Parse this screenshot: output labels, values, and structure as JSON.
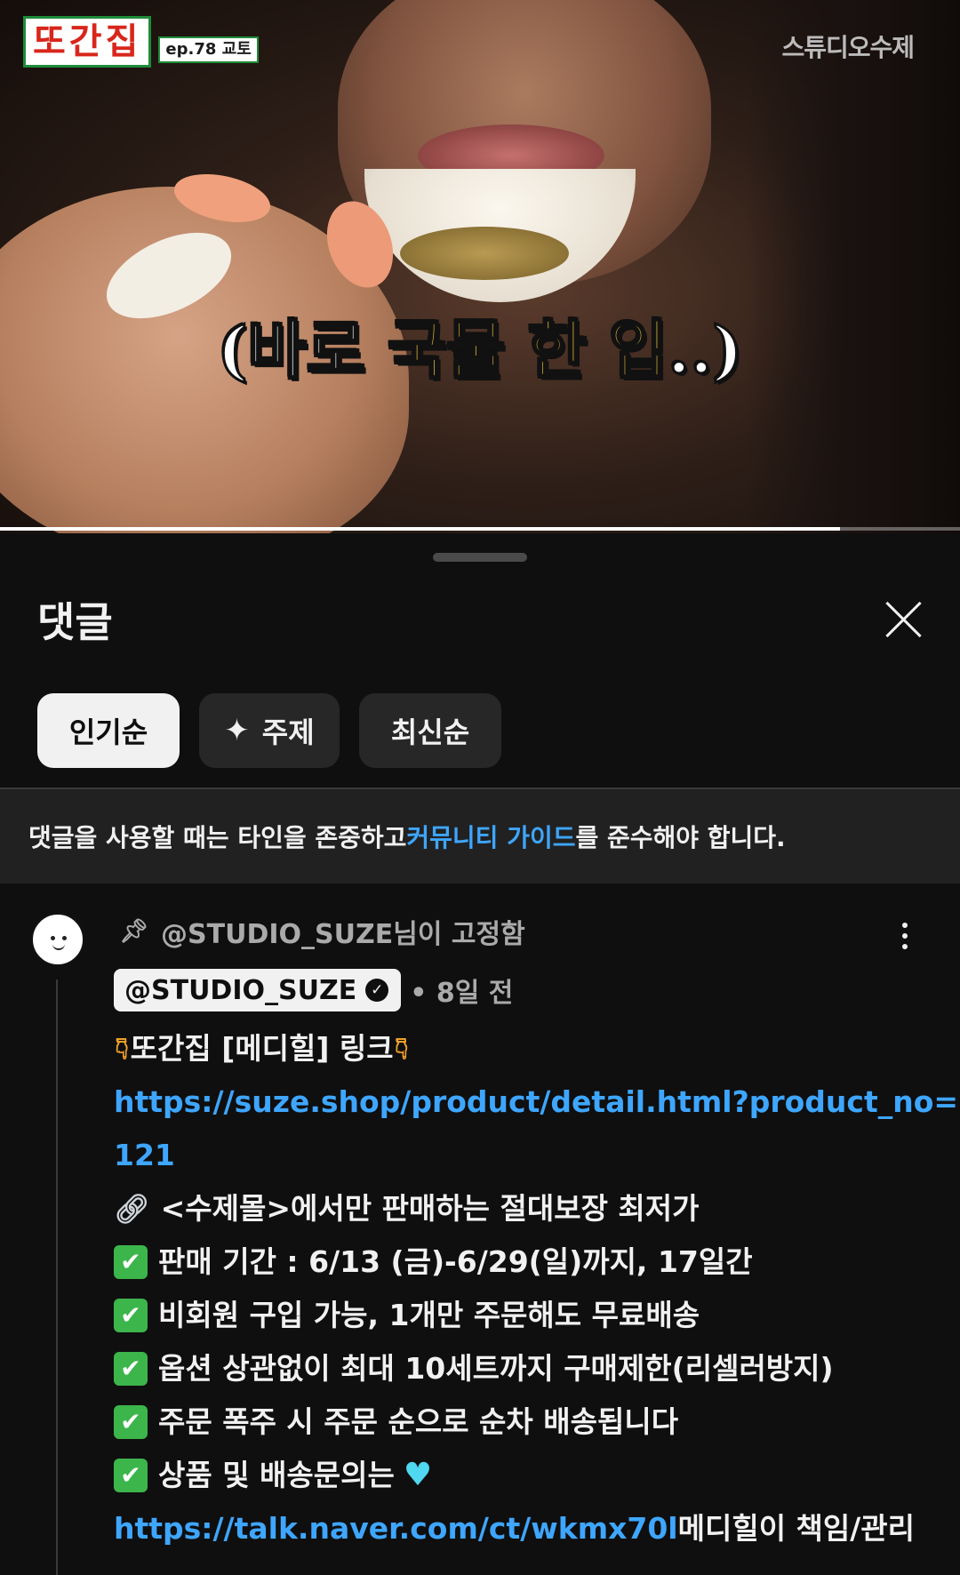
{
  "video": {
    "logo_title": "또간집",
    "logo_episode": "ep.78 교토",
    "watermark": "스튜디오수제",
    "subtitle_white": "(바로 ",
    "subtitle_yellow": "국물 한 입",
    "subtitle_end": "..)",
    "progress_fraction": 0.875
  },
  "sheet": {
    "title": "댓글",
    "close_icon": "close-icon"
  },
  "filters": [
    {
      "label": "인기순",
      "active": true
    },
    {
      "label": "주제",
      "icon": "sparkle-icon",
      "active": false
    },
    {
      "label": "최신순",
      "active": false
    }
  ],
  "notice": {
    "before": "댓글을 사용할 때는 타인을 존중하고 ",
    "link": "커뮤니티 가이드",
    "after": "를 준수해야 합니다."
  },
  "comment": {
    "pinned_text": "@STUDIO_SUZE님이 고정함",
    "author": "@STUDIO_SUZE",
    "time": "• 8일 전",
    "heading": "또간집 [메디힐] 링크",
    "url1_a": "https://suze.shop/product/detail.html?product_no=",
    "url1_b": "121",
    "exclusive": "<수제몰>에서만 판매하는 절대보장 최저가",
    "bullets": [
      "판매 기간 : 6/13 (금)-6/29(일)까지, 17일간",
      "비회원 구입 가능, 1개만 주문해도 무료배송",
      "옵션 상관없이 최대 10세트까지 구매제한(리셀러방지)",
      "주문 폭주 시 주문 순으로 순차 배송됩니다",
      "상품 및 배송문의는"
    ],
    "url2": "https://talk.naver.com/ct/wkmx70l",
    "url2_after": " 메디힐이 책임/관리"
  },
  "colors": {
    "link": "#3ea6ff",
    "background": "#0f0f0f",
    "chip": "#272727",
    "check": "#3cb54a"
  }
}
